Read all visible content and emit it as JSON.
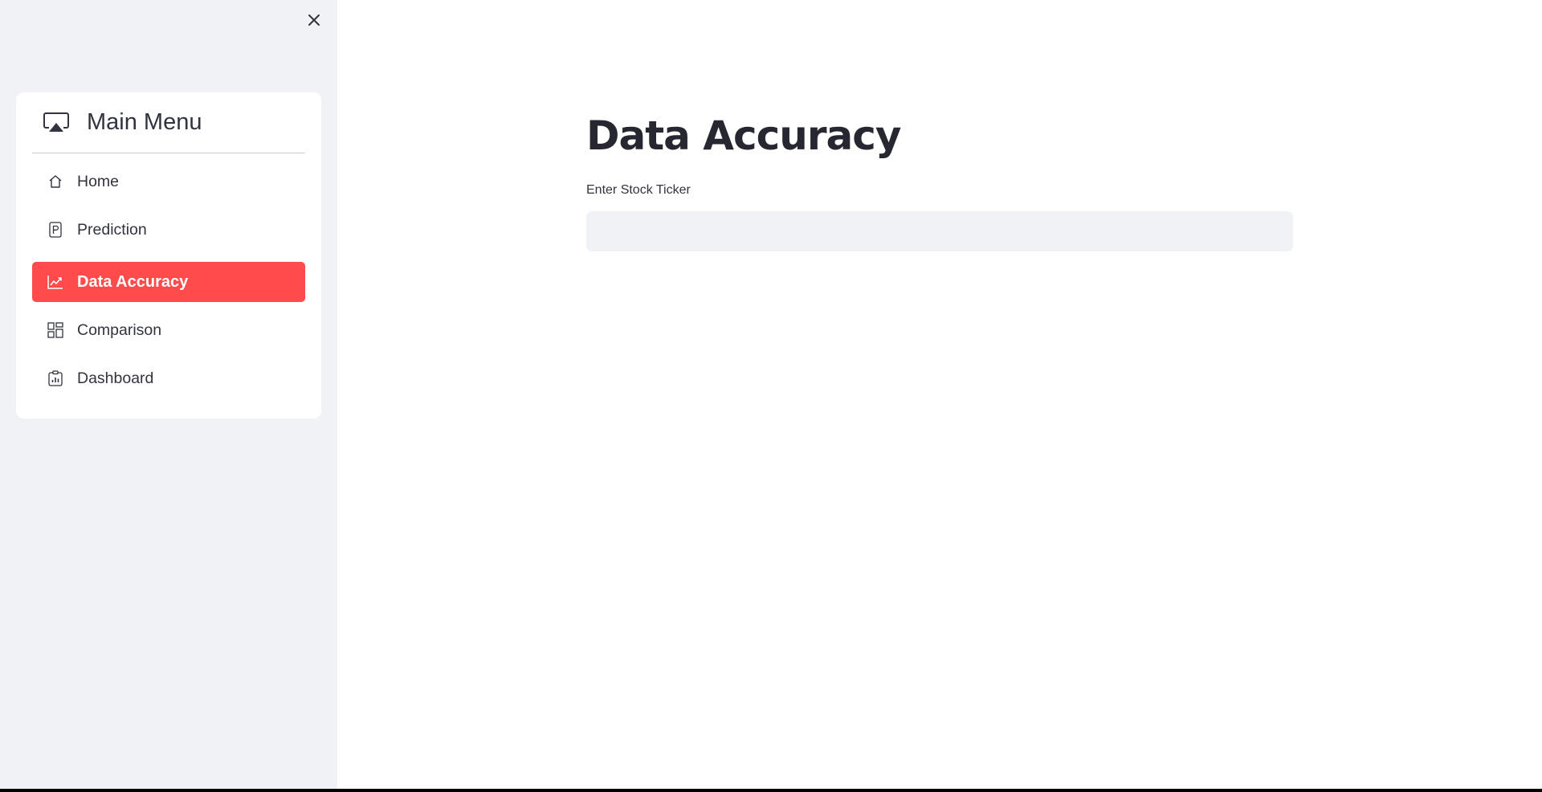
{
  "sidebar": {
    "close_icon": "close-icon",
    "menu": {
      "title": "Main Menu",
      "title_icon": "airplay-icon",
      "items": [
        {
          "label": "Home",
          "icon": "house-icon",
          "active": false
        },
        {
          "label": "Prediction",
          "icon": "p-square-icon",
          "active": false
        },
        {
          "label": "Data Accuracy",
          "icon": "graph-up-icon",
          "active": true
        },
        {
          "label": "Comparison",
          "icon": "grid-layout-icon",
          "active": false
        },
        {
          "label": "Dashboard",
          "icon": "clipboard-data-icon",
          "active": false
        }
      ]
    }
  },
  "main": {
    "title": "Data Accuracy",
    "ticker_field": {
      "label": "Enter Stock Ticker",
      "value": "",
      "placeholder": ""
    }
  },
  "colors": {
    "accent": "#ff4b4b",
    "sidebar_bg": "#f0f2f6",
    "input_bg": "#f0f2f6",
    "text": "#31333f"
  }
}
